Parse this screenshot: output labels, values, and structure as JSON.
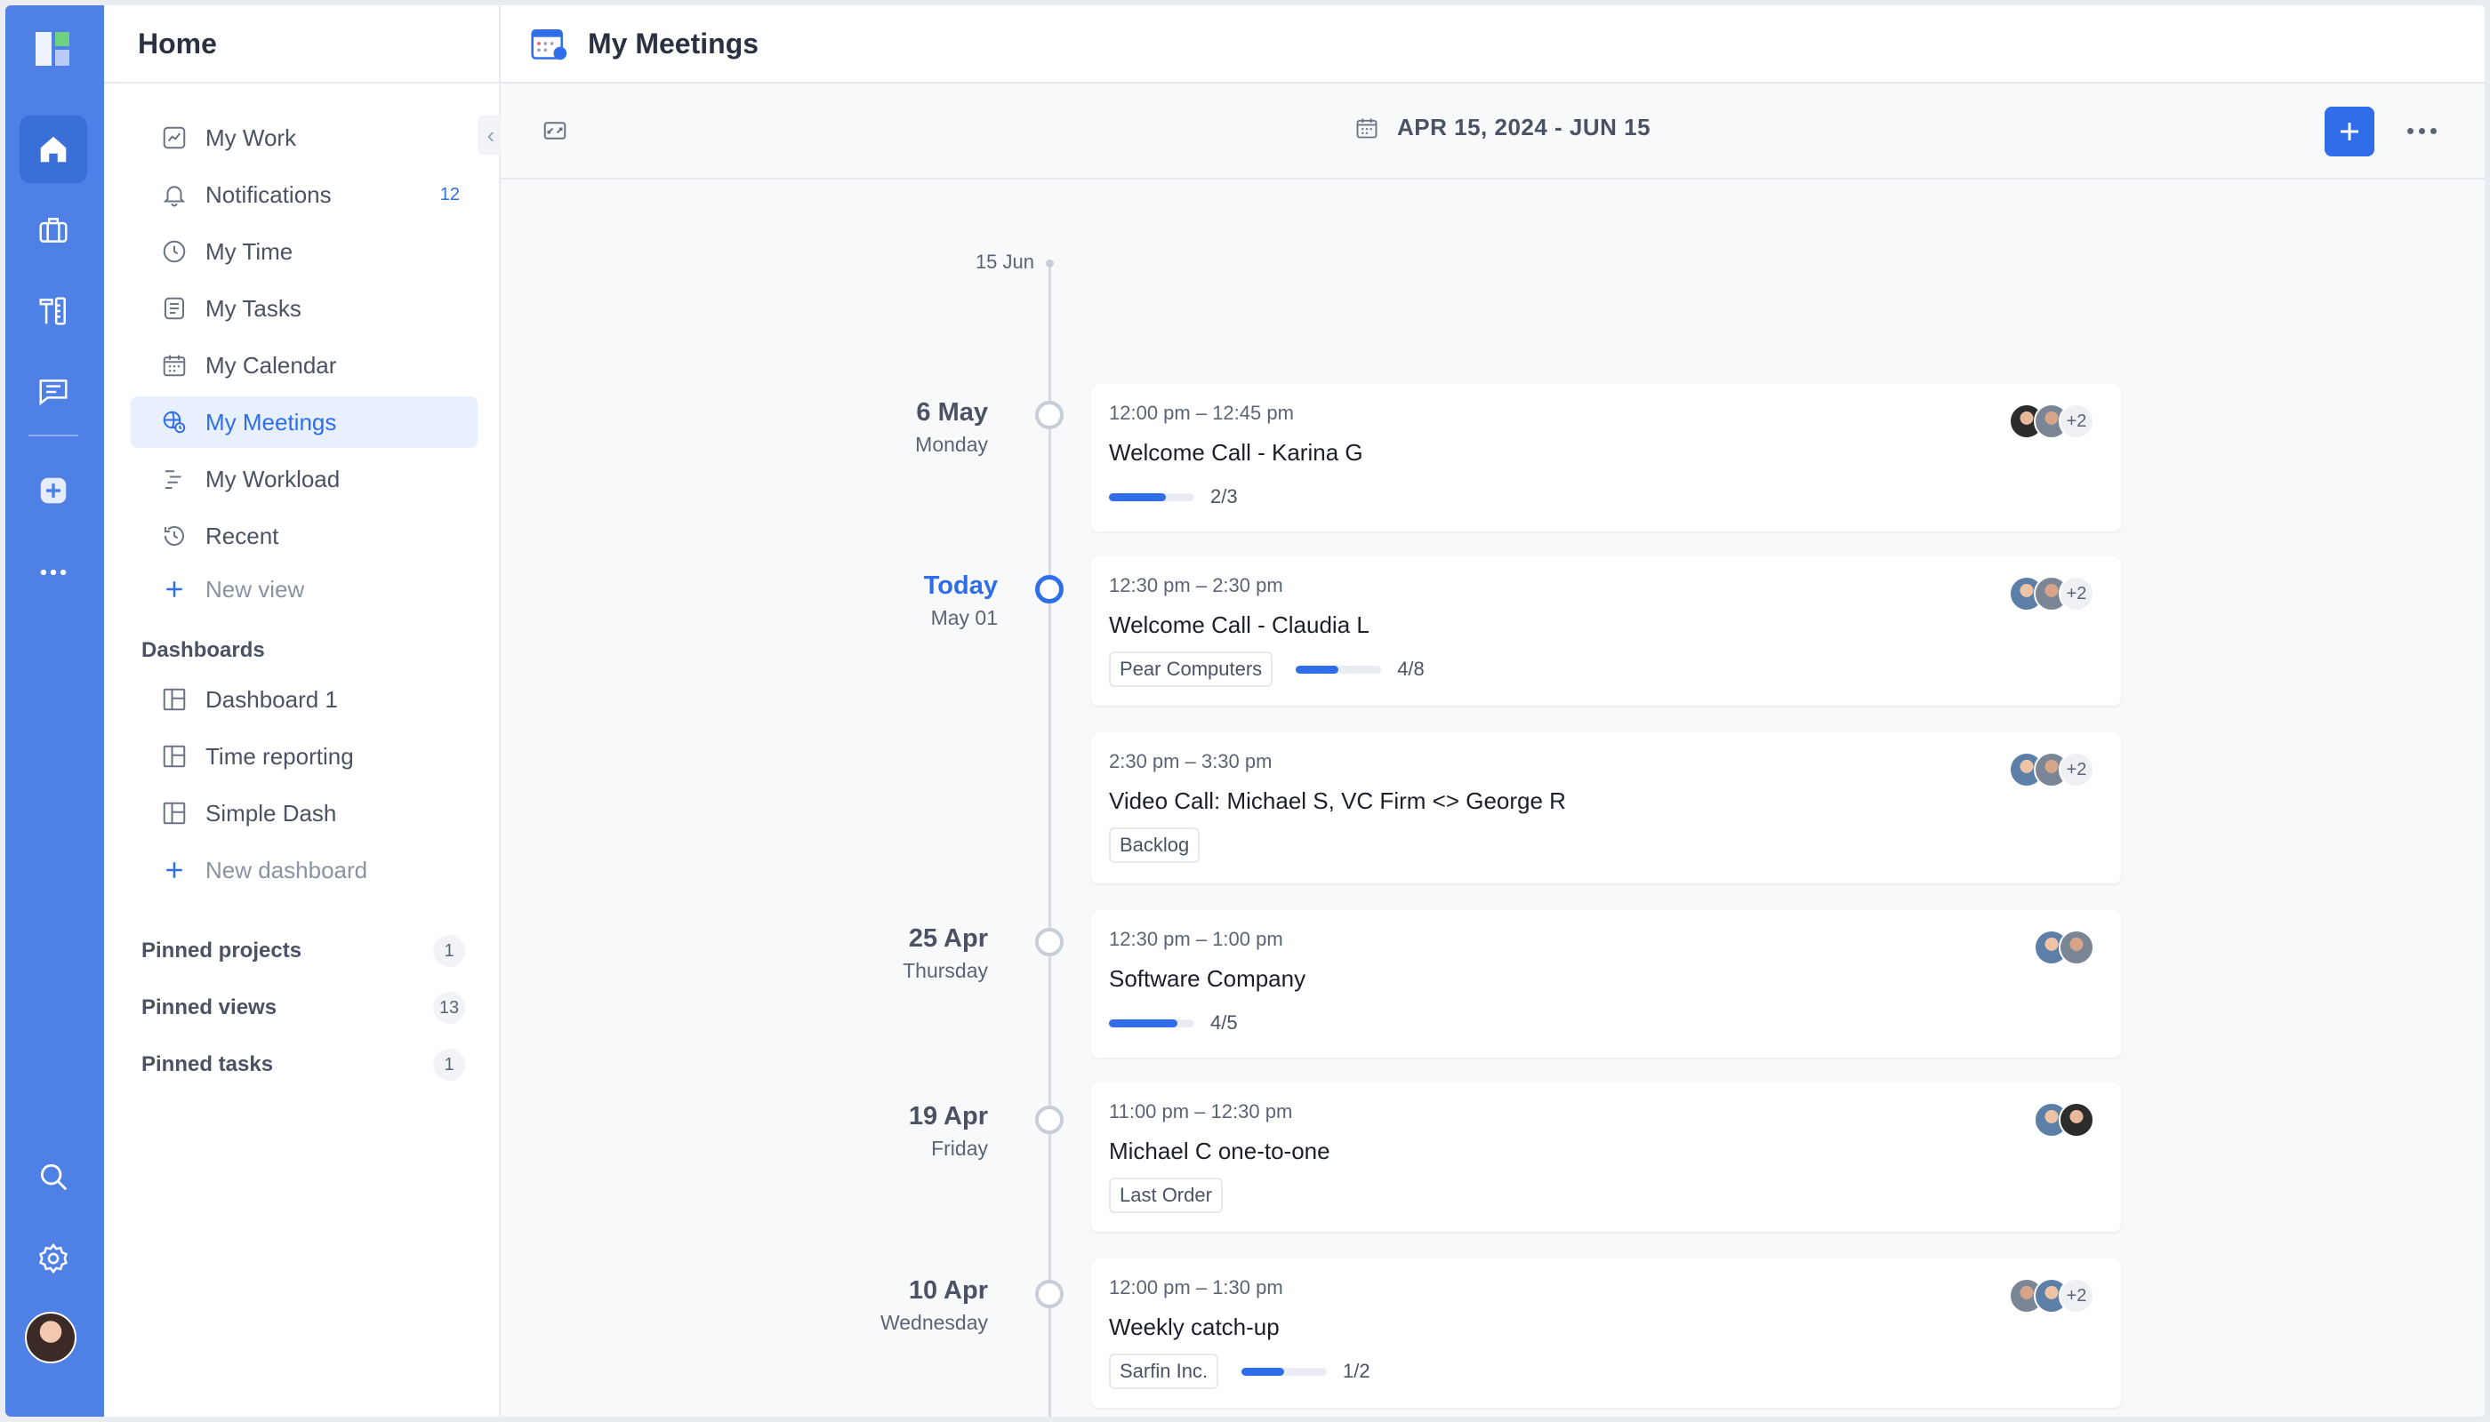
{
  "sidebar": {
    "title": "Home",
    "items": [
      {
        "label": "My Work",
        "icon": "chart-icon"
      },
      {
        "label": "Notifications",
        "icon": "bell-icon",
        "count": "12"
      },
      {
        "label": "My Time",
        "icon": "clock-icon"
      },
      {
        "label": "My Tasks",
        "icon": "tasks-icon"
      },
      {
        "label": "My Calendar",
        "icon": "calendar-icon"
      },
      {
        "label": "My Meetings",
        "icon": "meetings-icon",
        "active": true
      },
      {
        "label": "My Workload",
        "icon": "workload-icon"
      },
      {
        "label": "Recent",
        "icon": "history-icon"
      }
    ],
    "new_view": "New view",
    "dashboards_title": "Dashboards",
    "dashboards": [
      "Dashboard 1",
      "Time reporting",
      "Simple Dash"
    ],
    "new_dashboard": "New dashboard",
    "pinned": [
      {
        "label": "Pinned projects",
        "count": "1"
      },
      {
        "label": "Pinned views",
        "count": "13"
      },
      {
        "label": "Pinned tasks",
        "count": "1"
      }
    ]
  },
  "main": {
    "title": "My Meetings",
    "date_range": "APR 15, 2024 - JUN 15",
    "timeline_start": "15 Jun"
  },
  "days": [
    {
      "date": "6 May",
      "weekday": "Monday"
    },
    {
      "date": "Today",
      "weekday": "May  01"
    },
    {
      "date": "25 Apr",
      "weekday": "Thursday"
    },
    {
      "date": "19 Apr",
      "weekday": "Friday"
    },
    {
      "date": "10 Apr",
      "weekday": "Wednesday"
    }
  ],
  "meetings": [
    {
      "time": "12:00 pm – 12:45 pm",
      "title": "Welcome Call -  Karina G",
      "progress": "2/3",
      "progress_fraction": 0.667,
      "extra_attendees": "+2"
    },
    {
      "time": "12:30 pm – 2:30 pm",
      "title": "Welcome Call - Claudia L",
      "tag": "Pear Computers",
      "progress": "4/8",
      "progress_fraction": 0.5,
      "extra_attendees": "+2"
    },
    {
      "time": "2:30 pm – 3:30 pm",
      "title": "Video Call: Michael S, VC Firm <> George R",
      "tag": "Backlog",
      "extra_attendees": "+2"
    },
    {
      "time": "12:30 pm – 1:00 pm",
      "title": "Software Company",
      "progress": "4/5",
      "progress_fraction": 0.8
    },
    {
      "time": "11:00 pm – 12:30 pm",
      "title": "Michael C one-to-one",
      "tag": "Last Order"
    },
    {
      "time": "12:00 pm – 1:30 pm",
      "title": "Weekly catch-up",
      "tag": "Sarfin Inc.",
      "progress": "1/2",
      "progress_fraction": 0.5,
      "extra_attendees": "+2"
    }
  ],
  "colors": {
    "accent": "#2f6ee8",
    "rail": "#4f80e6"
  }
}
